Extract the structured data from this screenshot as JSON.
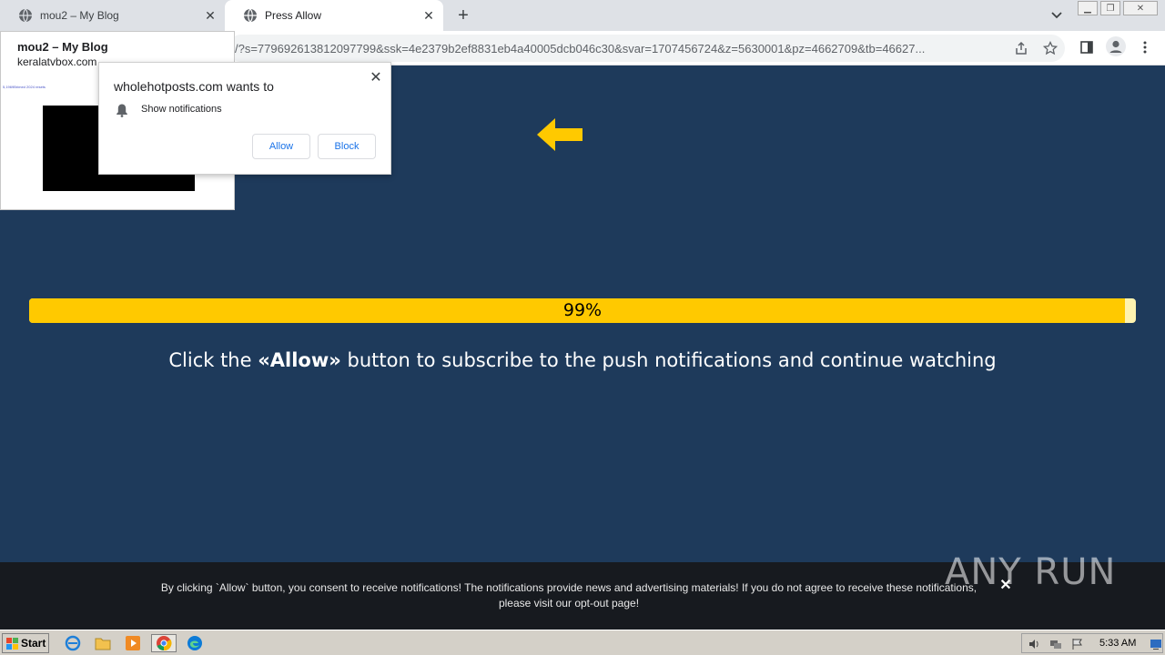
{
  "browser": {
    "tabs": [
      {
        "title": "mou2 – My Blog",
        "active": false
      },
      {
        "title": "Press Allow",
        "active": true
      }
    ],
    "url": "/?s=779692613812097799&ssk=4e2379b2ef8831eb4a40005dcb046c30&svar=1707456724&z=5630001&pz=4662709&tb=46627..."
  },
  "tab_preview": {
    "title": "mou2 – My Blog",
    "domain": "keralatvbox.com",
    "thumb_text": "5,1969Brimed 2024 resets"
  },
  "permission_popup": {
    "title": "wholehotposts.com wants to",
    "permission": "Show notifications",
    "allow_label": "Allow",
    "block_label": "Block"
  },
  "page": {
    "progress_percent": 99,
    "progress_label": "99%",
    "instruction_prefix": "Click the ",
    "instruction_bold": "«Allow»",
    "instruction_suffix": " button to subscribe to the push notifications and continue watching"
  },
  "consent": {
    "line1": "By clicking `Allow` button, you consent to receive notifications! The notifications provide news and advertising materials! If you do not agree to receive these notifications,",
    "line2_prefix": "please visit our ",
    "line2_link": "opt-out page",
    "line2_suffix": "!"
  },
  "watermark": "ANY RUN",
  "taskbar": {
    "start_label": "Start",
    "clock": "5:33 AM"
  },
  "colors": {
    "page_bg": "#1e3a5b",
    "accent_yellow": "#ffc900",
    "consent_bg": "#171a1f"
  }
}
